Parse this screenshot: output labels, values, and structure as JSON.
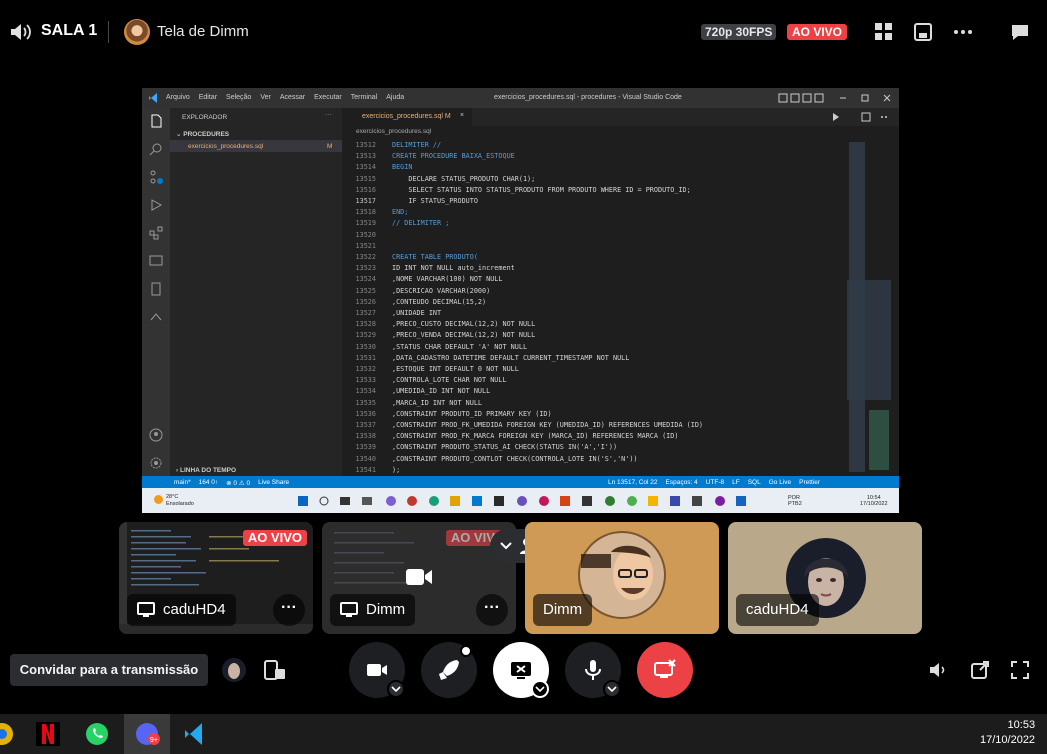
{
  "topbar": {
    "room_name": "SALA 1",
    "screen_title": "Tela de Dimm",
    "quality": "720p 30FPS",
    "live": "AO VIVO",
    "icons": [
      "speaker-icon",
      "grid-icon",
      "popout-icon",
      "more-icon",
      "chat-icon"
    ]
  },
  "vscode": {
    "menu": [
      "Arquivo",
      "Editar",
      "Seleção",
      "Ver",
      "Acessar",
      "Executar",
      "Terminal",
      "Ajuda"
    ],
    "window_title": "exercicios_procedures.sql - procedures - Visual Studio Code",
    "explorer_title": "EXPLORADOR",
    "folder": "PROCEDURES",
    "file": "exercicios_procedures.sql",
    "file_badge": "M",
    "tab_label": "exercicios_procedures.sql M",
    "breadcrumb": "exercicios_procedures.sql",
    "timeline": "LINHA DO TEMPO",
    "lines": [
      {
        "n": "13512",
        "t": "DELIMITER //"
      },
      {
        "n": "13513",
        "t": "CREATE PROCEDURE BAIXA_ESTOQUE"
      },
      {
        "n": "13514",
        "t": "BEGIN"
      },
      {
        "n": "13515",
        "t": "    DECLARE STATUS_PRODUTO CHAR(1);"
      },
      {
        "n": "13516",
        "t": "    SELECT STATUS INTO STATUS_PRODUTO FROM PRODUTO WHERE ID = PRODUTO_ID;"
      },
      {
        "n": "13517",
        "t": "    IF STATUS_PRODUTO"
      },
      {
        "n": "13518",
        "t": "END;"
      },
      {
        "n": "13519",
        "t": "// DELIMITER ;"
      },
      {
        "n": "13520",
        "t": ""
      },
      {
        "n": "13521",
        "t": ""
      },
      {
        "n": "13522",
        "t": "CREATE TABLE PRODUTO("
      },
      {
        "n": "13523",
        "t": "ID INT NOT NULL auto_increment"
      },
      {
        "n": "13524",
        "t": ",NOME VARCHAR(100) NOT NULL"
      },
      {
        "n": "13525",
        "t": ",DESCRICAO VARCHAR(2000)"
      },
      {
        "n": "13526",
        "t": ",CONTEUDO DECIMAL(15,2)"
      },
      {
        "n": "13527",
        "t": ",UNIDADE INT"
      },
      {
        "n": "13528",
        "t": ",PRECO_CUSTO DECIMAL(12,2) NOT NULL"
      },
      {
        "n": "13529",
        "t": ",PRECO_VENDA DECIMAL(12,2) NOT NULL"
      },
      {
        "n": "13530",
        "t": ",STATUS CHAR DEFAULT 'A' NOT NULL"
      },
      {
        "n": "13531",
        "t": ",DATA_CADASTRO DATETIME DEFAULT CURRENT_TIMESTAMP NOT NULL"
      },
      {
        "n": "13532",
        "t": ",ESTOQUE INT DEFAULT 0 NOT NULL"
      },
      {
        "n": "13533",
        "t": ",CONTROLA_LOTE CHAR NOT NULL"
      },
      {
        "n": "13534",
        "t": ",UMEDIDA_ID INT NOT NULL"
      },
      {
        "n": "13535",
        "t": ",MARCA_ID INT NOT NULL"
      },
      {
        "n": "13536",
        "t": ",CONSTRAINT PRODUTO_ID PRIMARY KEY (ID)"
      },
      {
        "n": "13537",
        "t": ",CONSTRAINT PROD_FK_UMEDIDA FOREIGN KEY (UMEDIDA_ID) REFERENCES UMEDIDA (ID)"
      },
      {
        "n": "13538",
        "t": ",CONSTRAINT PROD_FK_MARCA FOREIGN KEY (MARCA_ID) REFERENCES MARCA (ID)"
      },
      {
        "n": "13539",
        "t": ",CONSTRAINT PRODUTO_STATUS_AI CHECK(STATUS IN('A','I'))"
      },
      {
        "n": "13540",
        "t": ",CONSTRAINT PRODUTO_CONTLOT CHECK(CONTROLA_LOTE IN('S','N'))"
      },
      {
        "n": "13541",
        "t": ");"
      }
    ],
    "status_left": [
      "main*",
      "164 0↑",
      "⊗ 0 ⚠ 0",
      "Live Share"
    ],
    "status_right": [
      "Ln 13517, Col 22",
      "Espaços: 4",
      "UTF-8",
      "LF",
      "SQL",
      "Go Live",
      "Prettier"
    ],
    "weather_temp": "28°C",
    "weather_desc": "Ensolarado",
    "tray_lang": "POR",
    "tray_layout": "PTB2",
    "tray_time": "10:54",
    "tray_date": "17/10/2022"
  },
  "tiles": [
    {
      "name": "caduHD4",
      "live": "AO VIVO"
    },
    {
      "name": "Dimm",
      "live": "AO VIVO"
    },
    {
      "name": "Dimm"
    },
    {
      "name": "caduHD4"
    }
  ],
  "controls": {
    "invite": "Convidar para a transmissão"
  },
  "taskbar": {
    "time": "10:53",
    "date": "17/10/2022",
    "colors": {
      "accent": "#ed4245",
      "vscode_blue": "#007acc",
      "discord_red": "#ed4245"
    }
  }
}
